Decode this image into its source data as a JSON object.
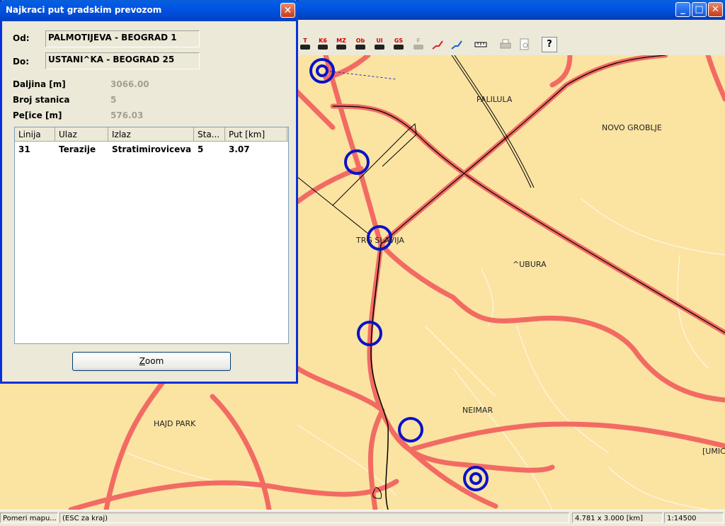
{
  "dialog": {
    "title": "Najkraci put gradskim prevozom",
    "from_label": "Od:",
    "from_value": "PALMOTIJEVA - BEOGRAD 1",
    "to_label": "Do:",
    "to_value": "USTANI^KA - BEOGRAD 25",
    "stats": [
      {
        "label": "Daljina [m]",
        "value": "3066.00"
      },
      {
        "label": "Broj stanica",
        "value": "5"
      },
      {
        "label": "Pe[ice [m]",
        "value": "576.03"
      }
    ],
    "table": {
      "columns": [
        "Linija",
        "Ulaz",
        "Izlaz",
        "Sta...",
        "Put [km]"
      ],
      "rows": [
        [
          "31",
          "Terazije",
          "Stratimiroviceva",
          "5",
          "3.07"
        ]
      ]
    },
    "zoom_label_first": "Z",
    "zoom_label_rest": "oom"
  },
  "toolbar": {
    "buttons": [
      {
        "code": "T",
        "icon": "car-icon"
      },
      {
        "code": "K6",
        "icon": "car-icon"
      },
      {
        "code": "MZ",
        "icon": "car-icon"
      },
      {
        "code": "Ob",
        "icon": "car-icon"
      },
      {
        "code": "Ul",
        "icon": "car-icon"
      },
      {
        "code": "GS",
        "icon": "car-icon"
      },
      {
        "code": "F",
        "icon": "car-icon"
      }
    ],
    "help_label": "?"
  },
  "map": {
    "labels": [
      "PALILULA",
      "NOVO GROBLJE",
      "TRG SLAVIJA",
      "^UBURA",
      "NEIMAR",
      "HAJD PARK",
      "[UMIC"
    ],
    "colors": {
      "background": "#FBE3A2",
      "major_road": "#F26B63",
      "route": "#000000",
      "stop_marker": "#0A12C8"
    }
  },
  "statusbar": {
    "hint": "Pomeri mapu...",
    "esc": "(ESC za kraj)",
    "scale": "4.781 x 3.000 [km]",
    "extra": "1:14500"
  }
}
